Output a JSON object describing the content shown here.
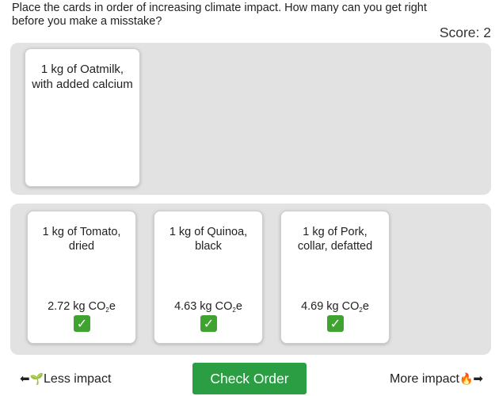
{
  "instructions": "Place the cards in order of increasing climate impact. How many can you get right before you make a misstake?",
  "score_label": "Score: 2",
  "pending_card": {
    "title": "1 kg of Oatmilk, with added calcium"
  },
  "placed_cards": [
    {
      "title": "1 kg of Tomato, dried",
      "co2_value": "2.72 kg CO",
      "co2_sub": "2",
      "co2_suffix": "e",
      "status": "correct",
      "status_icon": "check-mark-icon"
    },
    {
      "title": "1 kg of Quinoa, black",
      "co2_value": "4.63 kg CO",
      "co2_sub": "2",
      "co2_suffix": "e",
      "status": "correct",
      "status_icon": "check-mark-icon"
    },
    {
      "title": "1 kg of Pork, collar, defatted",
      "co2_value": "4.69 kg CO",
      "co2_sub": "2",
      "co2_suffix": "e",
      "status": "correct",
      "status_icon": "check-mark-icon"
    }
  ],
  "footer": {
    "less_label": "Less impact",
    "more_label": "More impact",
    "check_button_label": "Check Order",
    "arrow_left": "⬅",
    "arrow_right": "➡",
    "sprout_glyph": "🌱",
    "fire_glyph": "🔥",
    "check_glyph": "✓"
  },
  "colors": {
    "accent": "#2b9e43",
    "panel": "#e2e2e2",
    "check": "#3fa32f"
  }
}
